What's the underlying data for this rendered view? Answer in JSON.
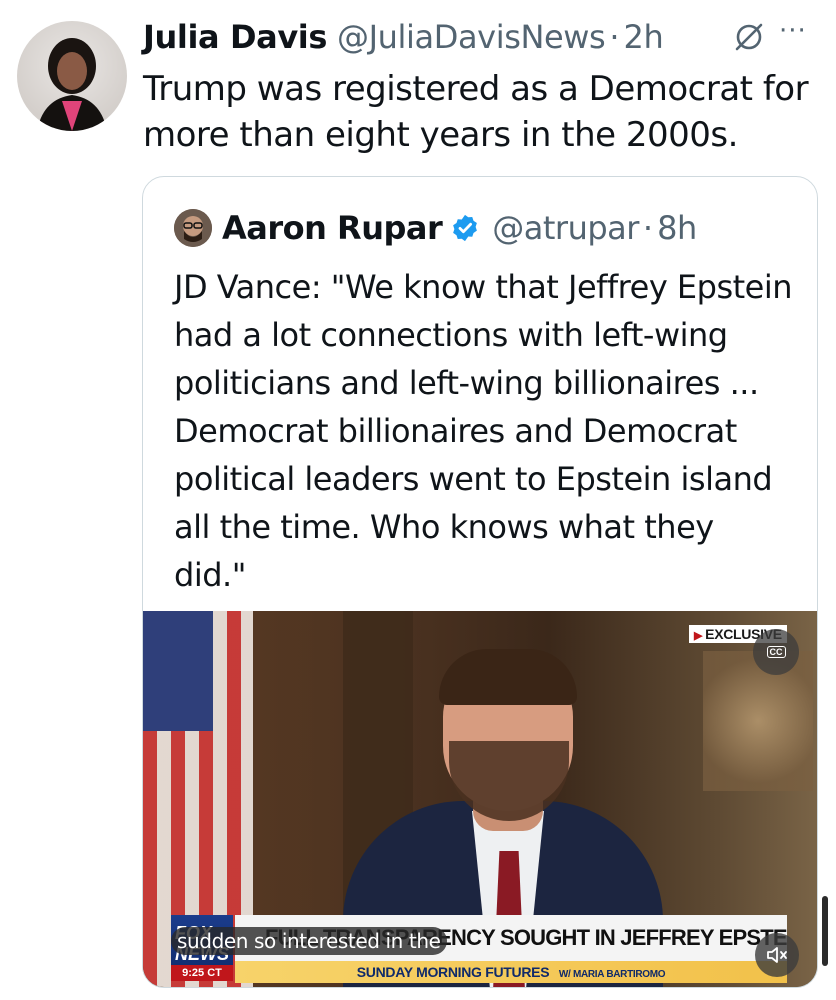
{
  "tweet": {
    "author_name": "Julia Davis",
    "author_handle": "@JuliaDavisNews",
    "time": "2h",
    "text": "Trump was registered as a Democrat for more than eight years in the 2000s.",
    "more_label": "···",
    "icons": {
      "grok": "grok-icon",
      "more": "more-icon",
      "avatar": "avatar"
    }
  },
  "quote": {
    "author_name": "Aaron Rupar",
    "author_handle": "@atrupar",
    "time": "8h",
    "verified": true,
    "text": "JD Vance: \"We know that Jeffrey Epstein had a lot connections with left-wing politicians and left-wing billionaires ... Democrat billionaires and Democrat political leaders went to Epstein island all the time. Who knows what they did.\"",
    "video": {
      "badge": "EXCLUSIVE",
      "cc_label": "CC",
      "network_logo": "FOX NEWS",
      "clock": "9:25 CT",
      "headline": "FULL TRANSPARENCY SOUGHT IN JEFFREY EPSTEIN CASE",
      "show": "SUNDAY MORNING FUTURES",
      "host": "W/ MARIA BARTIROMO",
      "caption": "sudden so interested in the",
      "muted": true
    }
  },
  "dot": "·",
  "colors": {
    "text": "#0f1419",
    "muted": "#536471",
    "verified": "#1d9bf0",
    "border": "#cfd9de"
  }
}
